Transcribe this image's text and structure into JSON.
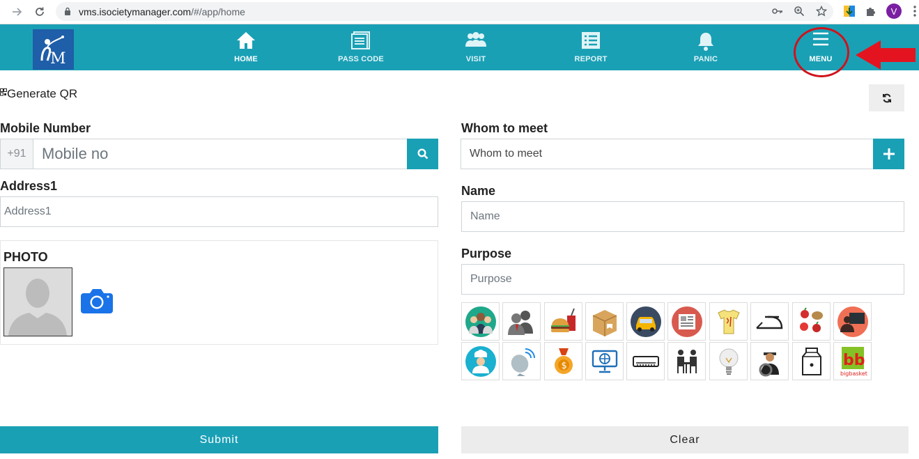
{
  "browser": {
    "url_host": "vms.isocietymanager.com",
    "url_path": "/#/app/home",
    "profile_initial": "V"
  },
  "appbar": {
    "logo_alt": "iSM",
    "nav": [
      {
        "label": "HOME",
        "icon": "home-icon"
      },
      {
        "label": "PASS CODE",
        "icon": "passcode-icon"
      },
      {
        "label": "VISIT",
        "icon": "visit-icon"
      },
      {
        "label": "REPORT",
        "icon": "report-icon"
      },
      {
        "label": "PANIC",
        "icon": "bell-icon"
      },
      {
        "label": "MENU",
        "icon": "hamburger-icon"
      }
    ],
    "color": "#1aa0b5"
  },
  "generate_qr": "Generate QR",
  "form": {
    "mobile_label": "Mobile Number",
    "country_code": "+91",
    "mobile_placeholder": "Mobile no",
    "address_label": "Address1",
    "address_placeholder": "Address1",
    "photo_label": "PHOTO",
    "whom_label": "Whom to meet",
    "whom_placeholder": "Whom to meet",
    "name_label": "Name",
    "name_placeholder": "Name",
    "purpose_label": "Purpose",
    "purpose_placeholder": "Purpose"
  },
  "purpose_icons": [
    "family-visit-icon",
    "meeting-icon",
    "food-delivery-icon",
    "courier-icon",
    "taxi-icon",
    "newspaper-icon",
    "laundry-icon",
    "iron-icon",
    "vegetables-icon",
    "tutor-icon",
    "cook-icon",
    "dish-service-icon",
    "donation-icon",
    "internet-icon",
    "ac-service-icon",
    "guest-icon",
    "electrician-icon",
    "driver-icon",
    "milk-icon",
    "bigbasket-icon"
  ],
  "bigbasket_text": "bigbasket",
  "actions": {
    "submit": "Submit",
    "clear": "Clear"
  }
}
